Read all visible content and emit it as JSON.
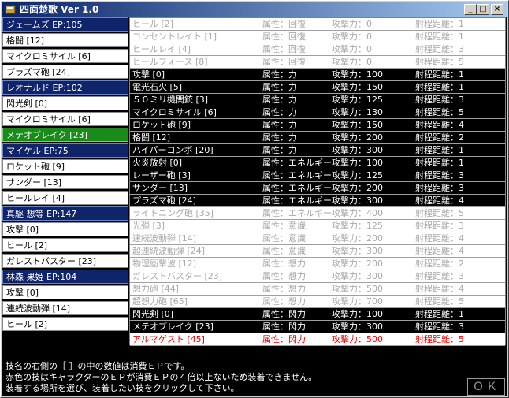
{
  "window": {
    "title": "四面楚歌 Ver 1.0",
    "minimize_glyph": "_",
    "maximize_glyph": "□",
    "close_glyph": "×"
  },
  "left_list": [
    {
      "type": "char",
      "text": "ジェームズ EP:105"
    },
    {
      "type": "skill",
      "text": "格闘 [12]"
    },
    {
      "type": "skill",
      "text": "マイクロミサイル [6]"
    },
    {
      "type": "skill",
      "text": "プラズマ砲 [24]"
    },
    {
      "type": "char",
      "text": "レオナルド EP:102"
    },
    {
      "type": "skill",
      "text": "閃光剣 [0]"
    },
    {
      "type": "skill",
      "text": "マイクロミサイル [6]"
    },
    {
      "type": "sel",
      "text": "メテオブレイク [23]"
    },
    {
      "type": "char",
      "text": "マイケル EP:75"
    },
    {
      "type": "skill",
      "text": "ロケット砲 [9]"
    },
    {
      "type": "skill",
      "text": "サンダー [13]"
    },
    {
      "type": "skill",
      "text": "ヒールレイ [4]"
    },
    {
      "type": "char",
      "text": "真駆 想等 EP:147"
    },
    {
      "type": "skill",
      "text": "攻撃 [0]"
    },
    {
      "type": "skill",
      "text": "ヒール [2]"
    },
    {
      "type": "skill",
      "text": "ガレストバスター [23]"
    },
    {
      "type": "char",
      "text": "林森 果姫 EP:104"
    },
    {
      "type": "skill",
      "text": "攻撃 [0]"
    },
    {
      "type": "skill",
      "text": "連続波動弾 [14]"
    },
    {
      "type": "skill",
      "text": "ヒール [2]"
    }
  ],
  "skills": [
    {
      "s": "dis",
      "name": "ヒール [2]",
      "attr": "属性：回復",
      "atk": "攻撃力：0",
      "range": "射程距離：1"
    },
    {
      "s": "dis",
      "name": "コンセントレイト [1]",
      "attr": "属性：回復",
      "atk": "攻撃力：0",
      "range": "射程距離：1"
    },
    {
      "s": "dis",
      "name": "ヒールレイ [4]",
      "attr": "属性：回復",
      "atk": "攻撃力：0",
      "range": "射程距離：3"
    },
    {
      "s": "dis",
      "name": "ヒールフォース [8]",
      "attr": "属性：回復",
      "atk": "攻撃力：0",
      "range": "射程距離：5"
    },
    {
      "s": "ok",
      "name": "攻撃 [0]",
      "attr": "属性：力",
      "atk": "攻撃力：100",
      "range": "射程距離：1"
    },
    {
      "s": "ok",
      "name": "電光石火 [5]",
      "attr": "属性：力",
      "atk": "攻撃力：150",
      "range": "射程距離：1"
    },
    {
      "s": "ok",
      "name": "５０ミリ機関銃 [3]",
      "attr": "属性：力",
      "atk": "攻撃力：125",
      "range": "射程距離：3"
    },
    {
      "s": "ok",
      "name": "マイクロミサイル [6]",
      "attr": "属性：力",
      "atk": "攻撃力：130",
      "range": "射程距離：5"
    },
    {
      "s": "ok",
      "name": "ロケット砲 [9]",
      "attr": "属性：力",
      "atk": "攻撃力：150",
      "range": "射程距離：4"
    },
    {
      "s": "ok",
      "name": "格闘 [12]",
      "attr": "属性：力",
      "atk": "攻撃力：200",
      "range": "射程距離：2"
    },
    {
      "s": "ok",
      "name": "ハイパーコンボ [20]",
      "attr": "属性：力",
      "atk": "攻撃力：300",
      "range": "射程距離：1"
    },
    {
      "s": "ok",
      "name": "火炎放射 [0]",
      "attr": "属性：エネルギー",
      "atk": "攻撃力：100",
      "range": "射程距離：1"
    },
    {
      "s": "ok",
      "name": "レーザー砲 [3]",
      "attr": "属性：エネルギー",
      "atk": "攻撃力：125",
      "range": "射程距離：3"
    },
    {
      "s": "ok",
      "name": "サンダー [13]",
      "attr": "属性：エネルギー",
      "atk": "攻撃力：200",
      "range": "射程距離：3"
    },
    {
      "s": "ok",
      "name": "プラズマ砲 [24]",
      "attr": "属性：エネルギー",
      "atk": "攻撃力：300",
      "range": "射程距離：4"
    },
    {
      "s": "dis",
      "name": "ライトニング砲 [35]",
      "attr": "属性：エネルギー",
      "atk": "攻撃力：400",
      "range": "射程距離：5"
    },
    {
      "s": "dis",
      "name": "光弾 [3]",
      "attr": "属性：意識",
      "atk": "攻撃力：125",
      "range": "射程距離：3"
    },
    {
      "s": "dis",
      "name": "連続波動弾 [14]",
      "attr": "属性：意識",
      "atk": "攻撃力：200",
      "range": "射程距離：4"
    },
    {
      "s": "dis",
      "name": "超連続波動弾 [24]",
      "attr": "属性：意識",
      "atk": "攻撃力：300",
      "range": "射程距離：4"
    },
    {
      "s": "dis",
      "name": "物理衝撃波 [12]",
      "attr": "属性：想力",
      "atk": "攻撃力：200",
      "range": "射程距離：2"
    },
    {
      "s": "dis",
      "name": "ガレストバスター [23]",
      "attr": "属性：想力",
      "atk": "攻撃力：300",
      "range": "射程距離：3"
    },
    {
      "s": "dis",
      "name": "想力砲 [44]",
      "attr": "属性：想力",
      "atk": "攻撃力：500",
      "range": "射程距離：4"
    },
    {
      "s": "dis",
      "name": "超想力砲 [65]",
      "attr": "属性：想力",
      "atk": "攻撃力：700",
      "range": "射程距離：5"
    },
    {
      "s": "ok",
      "name": "閃光剣 [0]",
      "attr": "属性：閃力",
      "atk": "攻撃力：100",
      "range": "射程距離：1"
    },
    {
      "s": "ok",
      "name": "メテオブレイク [23]",
      "attr": "属性：閃力",
      "atk": "攻撃力：300",
      "range": "射程距離：3"
    },
    {
      "s": "red",
      "name": "アルマゲスト [45]",
      "attr": "属性：閃力",
      "atk": "攻撃力：500",
      "range": "射程距離：5"
    }
  ],
  "help": [
    "技名の右側の［ ］の中の数値は消費ＥＰです。",
    "赤色の技はキャラクターのＥＰが消費ＥＰの４倍以上ないため装着できません。",
    "装着する場所を選び、装着したい技をクリックして下さい。"
  ],
  "ok_label": "ＯＫ"
}
